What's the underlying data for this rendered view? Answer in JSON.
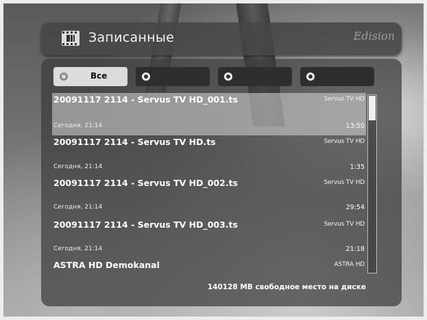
{
  "header": {
    "title": "Записанные",
    "brand": "Edision"
  },
  "tabs": [
    {
      "label": "Все",
      "active": true
    },
    {
      "label": "",
      "active": false
    },
    {
      "label": "",
      "active": false
    },
    {
      "label": "",
      "active": false
    }
  ],
  "recordings": [
    {
      "filename": "20091117 2114 - Servus TV HD_001.ts",
      "channel": "Servus TV HD",
      "date": "Сегодня, 21:14",
      "duration": "13:50",
      "selected": true
    },
    {
      "filename": "20091117 2114 - Servus TV HD.ts",
      "channel": "Servus TV HD",
      "date": "Сегодня, 21:14",
      "duration": "1:35",
      "selected": false
    },
    {
      "filename": "20091117 2114 - Servus TV HD_002.ts",
      "channel": "Servus TV HD",
      "date": "Сегодня, 21:14",
      "duration": "29:54",
      "selected": false
    },
    {
      "filename": "20091117 2114 - Servus TV HD_003.ts",
      "channel": "Servus TV HD",
      "date": "Сегодня, 21:14",
      "duration": "21:18",
      "selected": false
    },
    {
      "filename": "ASTRA HD Demokanal",
      "channel": "ASTRA HD",
      "date": "",
      "duration": "",
      "selected": false
    }
  ],
  "footer": {
    "free_space": "140128 MB свободное место на диске"
  },
  "icons": {
    "header": "film-icon",
    "tab": "radio-icon"
  },
  "colors": {
    "panel": "#3c3c3c",
    "selection": "#d7d7d7",
    "tab_active": "#dcdcdc",
    "tab_inactive": "#2e2e2e"
  }
}
